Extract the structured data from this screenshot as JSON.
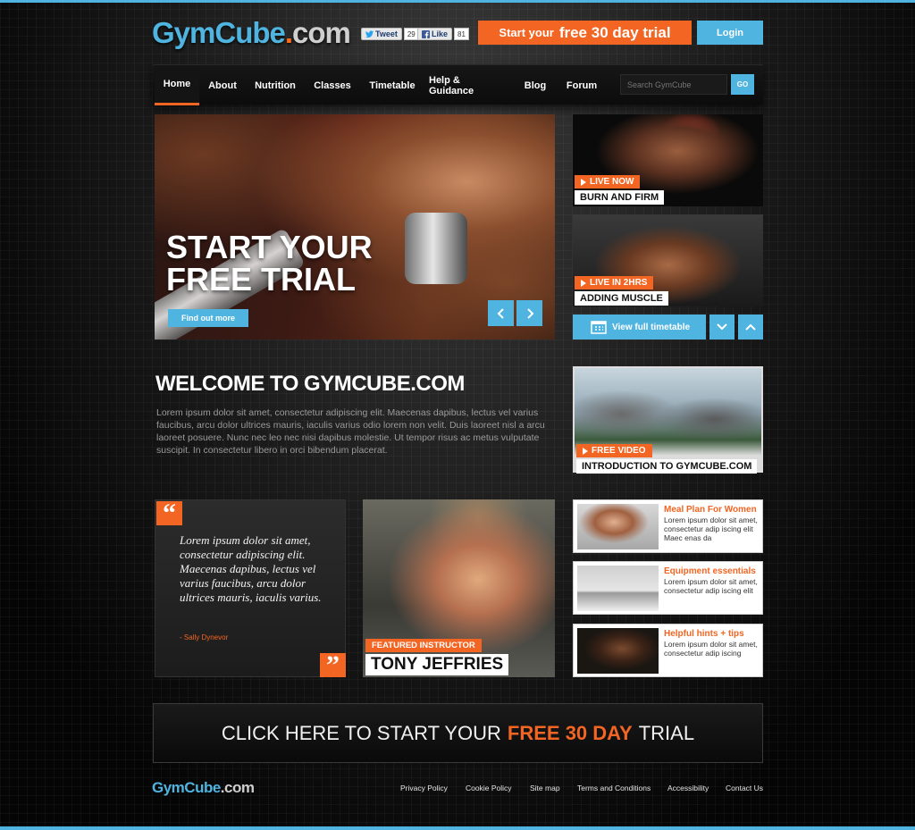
{
  "header": {
    "logo": {
      "part1": "GymCube",
      "part2": ".",
      "part3": "com"
    },
    "social": {
      "tweet_label": "Tweet",
      "tweet_count": "29",
      "like_label": "Like",
      "like_count": "81"
    },
    "trial_button": {
      "prefix": "Start your",
      "emphasis": "free 30 day trial"
    },
    "login_label": "Login"
  },
  "nav": {
    "items": [
      "Home",
      "About",
      "Nutrition",
      "Classes",
      "Timetable",
      "Help & Guidance",
      "Blog",
      "Forum"
    ],
    "active": "Home",
    "search_placeholder": "Search GymCube",
    "go_label": "GO"
  },
  "hero": {
    "title_line1": "START YOUR",
    "title_line2": "FREE TRIAL",
    "cta_label": "Find out more"
  },
  "promos": [
    {
      "badge": "LIVE NOW",
      "title": "BURN AND FIRM"
    },
    {
      "badge": "LIVE IN 2HRS",
      "title": "ADDING MUSCLE"
    }
  ],
  "timetable": {
    "label": "View full timetable"
  },
  "welcome": {
    "title": "WELCOME TO GYMCUBE.COM",
    "text": "Lorem ipsum dolor sit amet, consectetur adipiscing elit. Maecenas dapibus, lectus vel varius faucibus, arcu dolor ultrices mauris, iaculis varius odio lorem non velit. Duis laoreet nisl a arcu laoreet posuere. Nunc nec leo nec nisi dapibus molestie. Ut tempor risus ac metus vulputate suscipit. In consectetur libero in orci bibendum placerat."
  },
  "video": {
    "badge": "FREE VIDEO",
    "title": "INTRODUCTION TO GYMCUBE.COM"
  },
  "quote": {
    "open_mark": "“",
    "close_mark": "”",
    "text": "Lorem ipsum dolor sit amet, consectetur adipiscing elit. Maecenas dapibus, lectus vel varius faucibus, arcu dolor ultrices mauris, iaculis varius.",
    "author": "- Sally Dynevor"
  },
  "instructor": {
    "badge": "FEATURED INSTRUCTOR",
    "name": "TONY JEFFRIES"
  },
  "cards": [
    {
      "title": "Meal Plan For Women",
      "text": "Lorem ipsum dolor sit amet, consectetur adip iscing elit Maec enas da"
    },
    {
      "title": "Equipment essentials",
      "text": "Lorem ipsum dolor sit amet, consectetur adip iscing elit"
    },
    {
      "title": "Helpful hints + tips",
      "text": "Lorem ipsum dolor sit amet, consectetur adip iscing"
    }
  ],
  "cta": {
    "prefix": "CLICK HERE TO START YOUR",
    "emphasis": "FREE 30 DAY",
    "suffix": "TRIAL"
  },
  "footer": {
    "logo": {
      "part1": "GymCube",
      "part2": ".com"
    },
    "links": [
      "Privacy Policy",
      "Cookie Policy",
      "Site map",
      "Terms and Conditions",
      "Accessibility",
      "Contact Us"
    ]
  },
  "colors": {
    "accent_blue": "#4fb4e0",
    "accent_orange": "#f26522",
    "background": "#0b0b0b"
  },
  "icons": [
    "twitter-icon",
    "facebook-icon",
    "chevron-left-icon",
    "chevron-right-icon",
    "play-icon",
    "calendar-icon",
    "chevron-down-icon",
    "chevron-up-icon",
    "quote-open-icon",
    "quote-close-icon"
  ]
}
